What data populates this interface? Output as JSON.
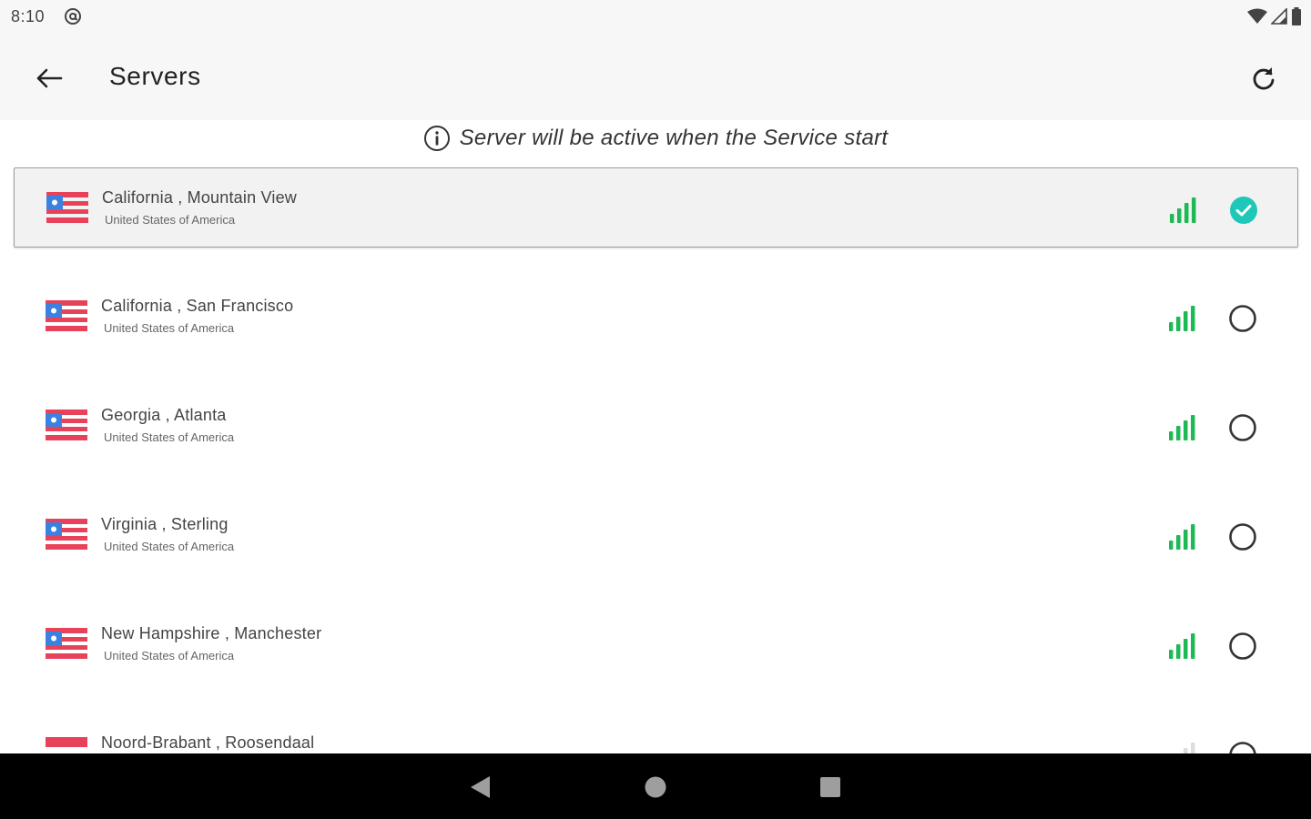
{
  "status_bar": {
    "time": "8:10",
    "app_icon": "at-sign-icon",
    "icons": [
      "wifi-icon",
      "cell-signal-icon",
      "battery-icon"
    ]
  },
  "toolbar": {
    "back_icon": "arrow-left-icon",
    "title": "Servers",
    "refresh_icon": "refresh-icon"
  },
  "info": {
    "icon": "info-icon",
    "text": "Server will be active when the Service start"
  },
  "servers": [
    {
      "name": "California , Mountain View",
      "country": "United States of America",
      "flag": "us-flag-icon",
      "signal_bars": 4,
      "selected": true
    },
    {
      "name": "California , San Francisco",
      "country": "United States of America",
      "flag": "us-flag-icon",
      "signal_bars": 4,
      "selected": false
    },
    {
      "name": "Georgia , Atlanta",
      "country": "United States of America",
      "flag": "us-flag-icon",
      "signal_bars": 4,
      "selected": false
    },
    {
      "name": "Virginia , Sterling",
      "country": "United States of America",
      "flag": "us-flag-icon",
      "signal_bars": 4,
      "selected": false
    },
    {
      "name": "New Hampshire , Manchester",
      "country": "United States of America",
      "flag": "us-flag-icon",
      "signal_bars": 4,
      "selected": false
    },
    {
      "name": "Noord-Brabant , Roosendaal",
      "country": "",
      "flag": "nl-flag-icon",
      "signal_bars": 4,
      "selected": false
    }
  ],
  "nav_bar": {
    "buttons": [
      "back-triangle-icon",
      "home-circle-icon",
      "recents-square-icon"
    ]
  },
  "colors": {
    "signal_green": "#1db954",
    "check_teal": "#1ec8b8",
    "flag_red": "#e8425a",
    "flag_blue": "#3b82e0"
  }
}
